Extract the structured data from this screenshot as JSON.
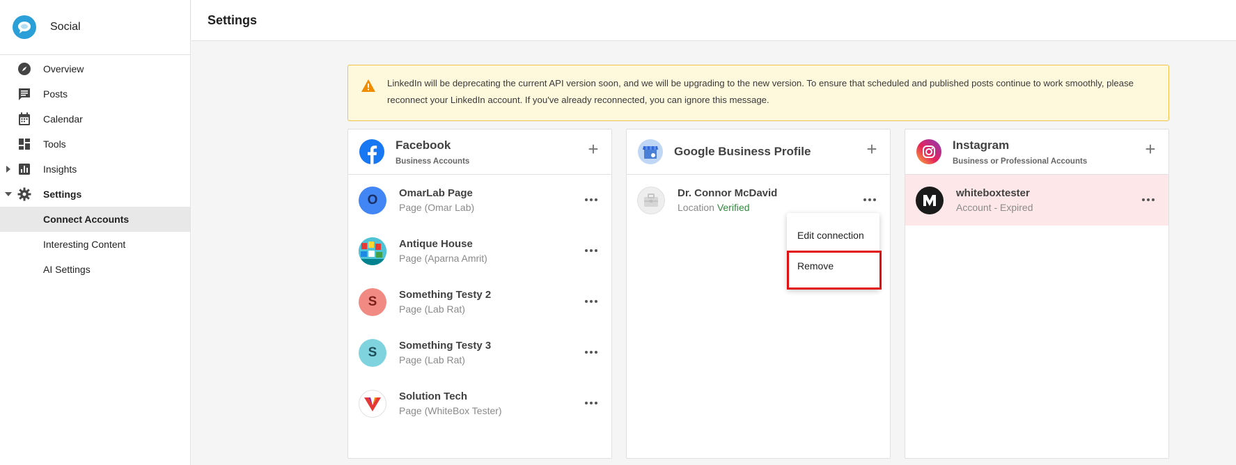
{
  "app": {
    "name": "Social",
    "page_title": "Settings"
  },
  "sidebar": {
    "items": [
      {
        "label": "Overview",
        "icon": "compass-icon"
      },
      {
        "label": "Posts",
        "icon": "posts-icon"
      },
      {
        "label": "Calendar",
        "icon": "calendar-icon"
      },
      {
        "label": "Tools",
        "icon": "tools-icon"
      },
      {
        "label": "Insights",
        "icon": "insights-icon"
      },
      {
        "label": "Settings",
        "icon": "gear-icon"
      }
    ],
    "sub_items": [
      "Connect Accounts",
      "Interesting Content",
      "AI Settings"
    ],
    "active": "Connect Accounts"
  },
  "alert": {
    "text": "LinkedIn will be deprecating the current API version soon, and we will be upgrading to the new version. To ensure that scheduled and published posts continue to work smoothly, please reconnect your LinkedIn account. If you've already reconnected, you can ignore this message."
  },
  "facebook": {
    "title": "Facebook",
    "subtitle": "Business Accounts",
    "accounts": [
      {
        "name": "OmarLab Page",
        "sub": "Page (Omar Lab)",
        "initial": "O"
      },
      {
        "name": "Antique House",
        "sub": "Page (Aparna Amrit)"
      },
      {
        "name": "Something Testy 2",
        "sub": "Page (Lab Rat)",
        "initial": "S"
      },
      {
        "name": "Something Testy 3",
        "sub": "Page (Lab Rat)",
        "initial": "S"
      },
      {
        "name": "Solution Tech",
        "sub": "Page (WhiteBox Tester)"
      }
    ]
  },
  "gbp": {
    "title": "Google Business Profile",
    "accounts": [
      {
        "name": "Dr. Connor McDavid",
        "sub_prefix": "Location",
        "status": "Verified"
      }
    ]
  },
  "instagram": {
    "title": "Instagram",
    "subtitle": "Business or Professional Accounts",
    "accounts": [
      {
        "name": "whiteboxtester",
        "sub": "Account - Expired"
      }
    ]
  },
  "menu": {
    "edit": "Edit connection",
    "remove": "Remove"
  },
  "colors": {
    "brand": "#2a9fd8",
    "alert_bg": "#fef8dc",
    "alert_border": "#f2c24a",
    "verified": "#2e8b3a",
    "expired_bg": "#fde7e9",
    "highlight": "#e01010"
  }
}
